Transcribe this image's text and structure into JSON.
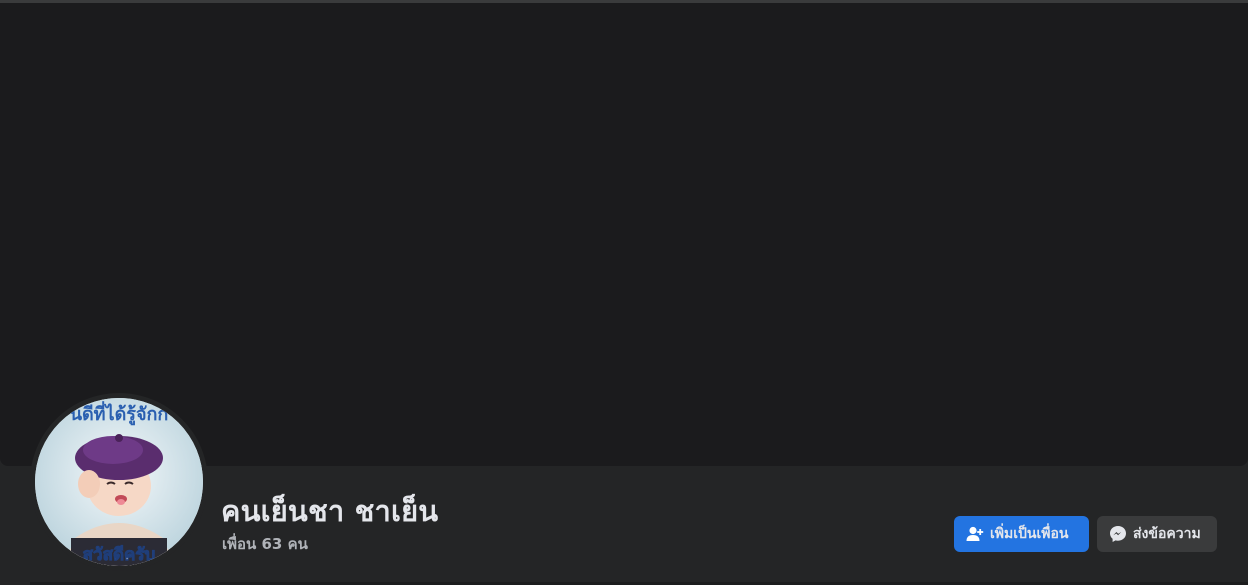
{
  "profile": {
    "name": "คนเย็นชา ชาเย็น",
    "friends_count": "เพื่อน 63 คน",
    "avatar_caption_top": "นดีที่ได้รู้จักก",
    "avatar_caption_bottom": "สวัสดีครับ"
  },
  "actions": {
    "add_friend_label": "เพิ่มเป็นเพื่อน",
    "message_label": "ส่งข้อความ"
  },
  "icons": {
    "add_friend": "person-plus-icon",
    "message": "messenger-icon"
  },
  "colors": {
    "primary_button": "#2374e1",
    "secondary_button": "#3a3b3c",
    "text_primary": "#e4e6eb",
    "text_secondary": "#b0b3b8",
    "cover": "#1b1b1d",
    "surface": "#242526"
  }
}
